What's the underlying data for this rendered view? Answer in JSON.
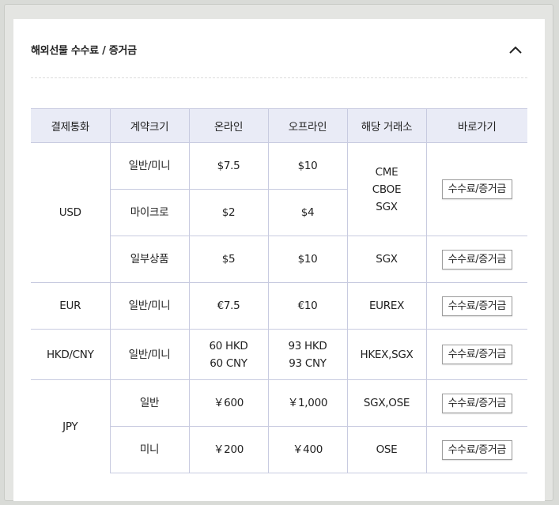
{
  "section": {
    "title": "해외선물 수수료 / 증거금"
  },
  "table": {
    "headers": [
      "결제통화",
      "계약크기",
      "온라인",
      "오프라인",
      "해당 거래소",
      "바로가기"
    ],
    "button_label": "수수료/증거금",
    "usd": {
      "currency": "USD",
      "rows": [
        {
          "size": "일반/미니",
          "online": "$7.5",
          "offline": "$10"
        },
        {
          "size": "마이크로",
          "online": "$2",
          "offline": "$4"
        },
        {
          "size": "일부상품",
          "online": "$5",
          "offline": "$10",
          "exchange": "SGX"
        }
      ],
      "exchanges": [
        "CME",
        "CBOE",
        "SGX"
      ]
    },
    "eur": {
      "currency": "EUR",
      "size": "일반/미니",
      "online": "€7.5",
      "offline": "€10",
      "exchange": "EUREX"
    },
    "hkd": {
      "currency": "HKD/CNY",
      "size": "일반/미니",
      "online": [
        "60 HKD",
        "60 CNY"
      ],
      "offline": [
        "93 HKD",
        "93 CNY"
      ],
      "exchange": "HKEX,SGX"
    },
    "jpy": {
      "currency": "JPY",
      "rows": [
        {
          "size": "일반",
          "online": "￥600",
          "offline": "￥1,000",
          "exchange": "SGX,OSE"
        },
        {
          "size": "미니",
          "online": "￥200",
          "offline": "￥400",
          "exchange": "OSE"
        }
      ]
    }
  }
}
